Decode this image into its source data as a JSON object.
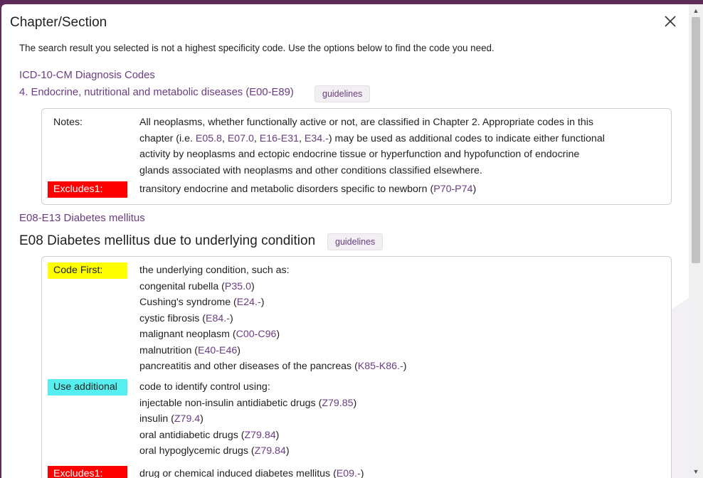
{
  "dialog": {
    "title": "Chapter/Section",
    "message": "The search result you selected is not a highest specificity code. Use the options below to find the code you need."
  },
  "breadcrumb": {
    "level1": "ICD-10-CM Diagnosis Codes",
    "level2": "4. Endocrine, nutritional and metabolic diseases (E00-E89)",
    "guidelines_label": "guidelines"
  },
  "chapter_notes": {
    "notes_label": "Notes:",
    "notes_line1": "All neoplasms, whether functionally active or not, are classified in Chapter 2. Appropriate codes in this",
    "notes_prefix": "chapter (i.e. ",
    "notes_codes": [
      "E05.8",
      "E07.0",
      "E16-E31",
      "E34.-"
    ],
    "notes_suffix": ") may be used as additional codes to indicate either functional",
    "notes_line3": "activity by neoplasms and ectopic endocrine tissue or hyperfunction and hypofunction of endocrine",
    "notes_line4": "glands associated with neoplasms and other conditions classified elsewhere.",
    "excludes_label": "Excludes1:",
    "excludes_text": "transitory endocrine and metabolic disorders specific to newborn (",
    "excludes_code": "P70-P74",
    "excludes_close": ")"
  },
  "section": {
    "link": "E08-E13 Diabetes mellitus"
  },
  "code": {
    "title": "E08 Diabetes mellitus due to underlying condition",
    "guidelines_label": "guidelines",
    "code_first_label": "Code First:",
    "code_first_intro": "the underlying condition, such as:",
    "code_first_items": [
      {
        "text": "congenital rubella (",
        "code": "P35.0",
        "close": ")"
      },
      {
        "text": "Cushing's syndrome (",
        "code": "E24.-",
        "close": ")"
      },
      {
        "text": "cystic fibrosis (",
        "code": "E84.-",
        "close": ")"
      },
      {
        "text": "malignant neoplasm (",
        "code": "C00-C96",
        "close": ")"
      },
      {
        "text": "malnutrition (",
        "code": "E40-E46",
        "close": ")"
      },
      {
        "text": "pancreatitis and other diseases of the pancreas (",
        "code": "K85-K86.-",
        "close": ")"
      }
    ],
    "use_additional_label": "Use additional",
    "use_additional_intro": "code to identify control using:",
    "use_additional_items": [
      {
        "text": "injectable non-insulin antidiabetic drugs (",
        "code": "Z79.85",
        "close": ")"
      },
      {
        "text": "insulin (",
        "code": "Z79.4",
        "close": ")"
      },
      {
        "text": "oral antidiabetic drugs (",
        "code": "Z79.84",
        "close": ")"
      },
      {
        "text": "oral hypoglycemic drugs (",
        "code": "Z79.84",
        "close": ")"
      }
    ],
    "excludes_label": "Excludes1:",
    "excludes_text": "drug or chemical induced diabetes mellitus (",
    "excludes_code": "E09.-",
    "excludes_close": ")"
  },
  "colors": {
    "link": "#6b3c83",
    "excludes_bg": "#ff0000",
    "code_first_bg": "#ffff00",
    "use_additional_bg": "#55efef"
  }
}
